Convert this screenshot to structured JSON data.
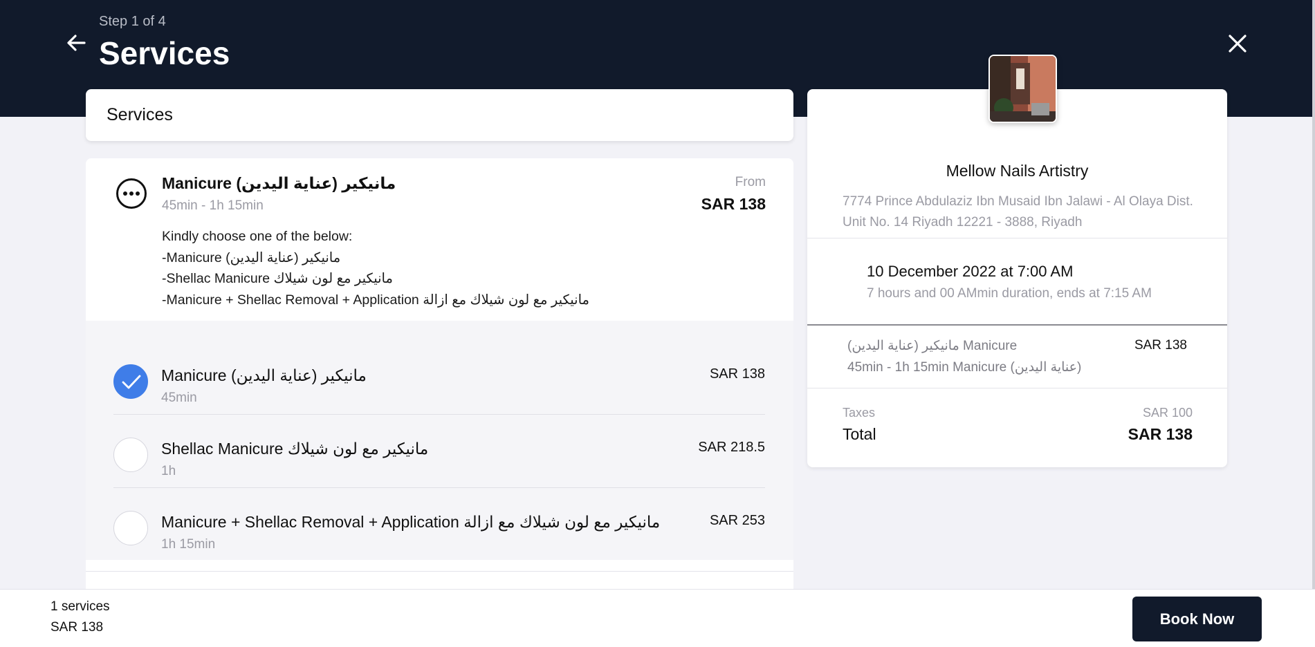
{
  "header": {
    "step": "Step 1 of 4",
    "title": "Services",
    "back_icon": "arrow-left-icon",
    "close_icon": "close-icon"
  },
  "section": {
    "title": "Services"
  },
  "service_group": {
    "icon": "more-options-icon",
    "name": "Manicure مانيكير (عناية اليدين)",
    "duration": "45min - 1h 15min",
    "from_label": "From",
    "from_price": "SAR 138",
    "description": [
      "Kindly choose one of the below:",
      "-Manicure مانيكير (عناية اليدين)",
      "-Shellac Manicure مانيكير مع لون شيلاك",
      "-Manicure + Shellac Removal + Application مانيكير مع لون شيلاك مع ازالة"
    ],
    "options": [
      {
        "name": "Manicure مانيكير (عناية اليدين)",
        "duration": "45min",
        "price": "SAR 138",
        "selected": true
      },
      {
        "name": "Shellac Manicure مانيكير مع لون شيلاك",
        "duration": "1h",
        "price": "SAR 218.5",
        "selected": false
      },
      {
        "name": "Manicure + Shellac Removal + Application مانيكير مع لون شيلاك مع ازالة",
        "duration": "1h 15min",
        "price": "SAR 253",
        "selected": false
      }
    ]
  },
  "summary": {
    "venue_name": "Mellow Nails Artistry",
    "address": "7774 Prince Abdulaziz Ibn Musaid Ibn Jalawi - Al Olaya Dist. Unit No. 14 Riyadh 12221 - 3888, Riyadh",
    "date": "10 December 2022 at 7:00 AM",
    "duration_text": "7 hours and 00 AMmin duration, ends at 7:15 AM",
    "item_name": "مانيكير (عناية اليدين) Manicure",
    "item_price": "SAR 138",
    "item_detail": "45min - 1h 15min Manicure (عناية اليدين)",
    "taxes_label": "Taxes",
    "taxes_value": "SAR 100",
    "total_label": "Total",
    "total_value": "SAR 138"
  },
  "footer": {
    "count": "1 services",
    "price": "SAR 138",
    "book_label": "Book Now"
  },
  "colors": {
    "header_bg": "#111a2b",
    "accent": "#3f7de8",
    "page_bg": "#f2f2f7"
  }
}
